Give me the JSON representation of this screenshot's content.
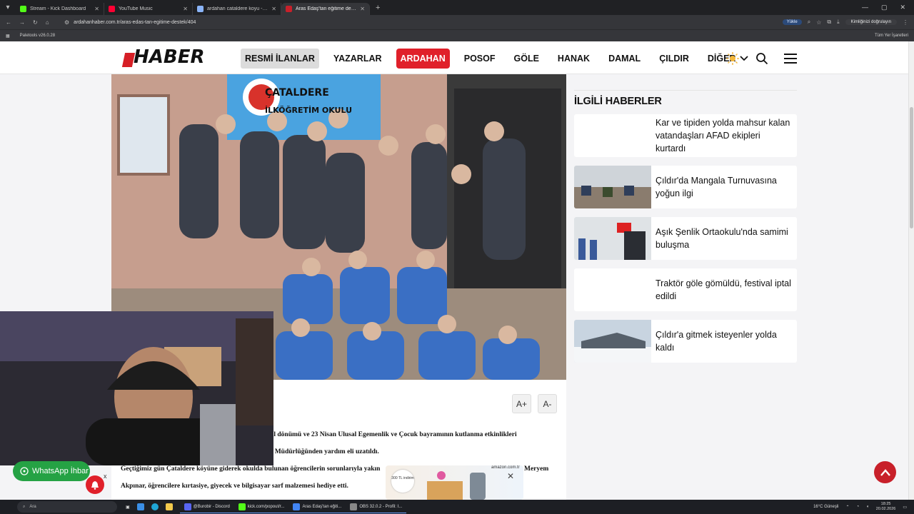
{
  "browser": {
    "tabs": [
      {
        "title": "Stream - Kick Dashboard",
        "color": "#53fc18",
        "active": false
      },
      {
        "title": "YouTube Music",
        "color": "#ff0033",
        "active": false
      },
      {
        "title": "ardahan cataldere koyu - Goog",
        "color": "#8ab4f8",
        "active": false
      },
      {
        "title": "Aras Edaş'tan eğitime destek -",
        "color": "#c8202a",
        "active": true
      }
    ],
    "url": "ardahanhaber.com.tr/aras-edas-tan-egitime-destek/404",
    "upload_label": "Yükle",
    "verify_label": "Kimliğinizi doğrulayın",
    "bookmark_item": "Paletools v26.0.28",
    "all_bookmarks": "Tüm Yer İşaretleri"
  },
  "site": {
    "logo_text": "HABER",
    "nav": [
      {
        "label": "RESMİ İLANLAR",
        "style": "gray"
      },
      {
        "label": "YAZARLAR",
        "style": "plain"
      },
      {
        "label": "ARDAHAN",
        "style": "red"
      },
      {
        "label": "POSOF",
        "style": "plain"
      },
      {
        "label": "GÖLE",
        "style": "plain"
      },
      {
        "label": "HANAK",
        "style": "plain"
      },
      {
        "label": "DAMAL",
        "style": "plain"
      },
      {
        "label": "ÇILDIR",
        "style": "plain"
      },
      {
        "label": "DİĞER",
        "style": "plain"
      }
    ],
    "accent": "#e0202a"
  },
  "article": {
    "photo_sign": [
      "ÇATALDERE",
      "İLKÖĞRETİM OKULU"
    ],
    "font_increase": "A+",
    "font_decrease": "A-",
    "paragraphs": [
      "yıl dönümü ve 23 Nisan Ulusal Egemenlik ve Çocuk bayramının kutlanma etkinlikleri",
      "İl Müdürlüğünden yardım eli uzatıldı.",
      "Geçtiğimiz gün Çataldere köyüne giderek okulda bulunan öğrencilerin sorunlarıyla yakın",
      "Akpınar, öğrencilere kırtasiye, giyecek ve bilgisayar sarf malzemesi hediye etti."
    ],
    "para3_tail": "Meryem"
  },
  "related": {
    "title": "İLGİLİ HABERLER",
    "items": [
      {
        "text": "Kar ve tipiden yolda mahsur kalan vatandaşları AFAD ekipleri kurtardı",
        "thumb": "none"
      },
      {
        "text": "Çıldır'da Mangala Turnuvasına yoğun ilgi",
        "thumb": "hall"
      },
      {
        "text": "Aşık Şenlik Ortaokulu'nda samimi buluşma",
        "thumb": "class"
      },
      {
        "text": "Traktör göle gömüldü, festival iptal edildi",
        "thumb": "none"
      },
      {
        "text": "Çıldır'a gitmek isteyenler yolda kaldı",
        "thumb": "snow"
      }
    ]
  },
  "overlays": {
    "whatsapp_label": "WhatsApp İhbar",
    "whatsapp_close": "x",
    "ad_badge": "300 TL indirim",
    "ad_brand": "amazon.com.tr"
  },
  "taskbar": {
    "search_placeholder": "Ara",
    "apps": [
      {
        "label": "@Burobir - Discord",
        "color": "#5865f2"
      },
      {
        "label": "kick.com/popout/r...",
        "color": "#53fc18"
      },
      {
        "label": "Aras Edaş'tan eğiti...",
        "color": "#4285f4"
      },
      {
        "label": "OBS 32.0.2 - Profil: I...",
        "color": "#888888"
      }
    ],
    "weather": "16°C Güneşli",
    "time": "18:25",
    "date": "20.02.2026"
  }
}
